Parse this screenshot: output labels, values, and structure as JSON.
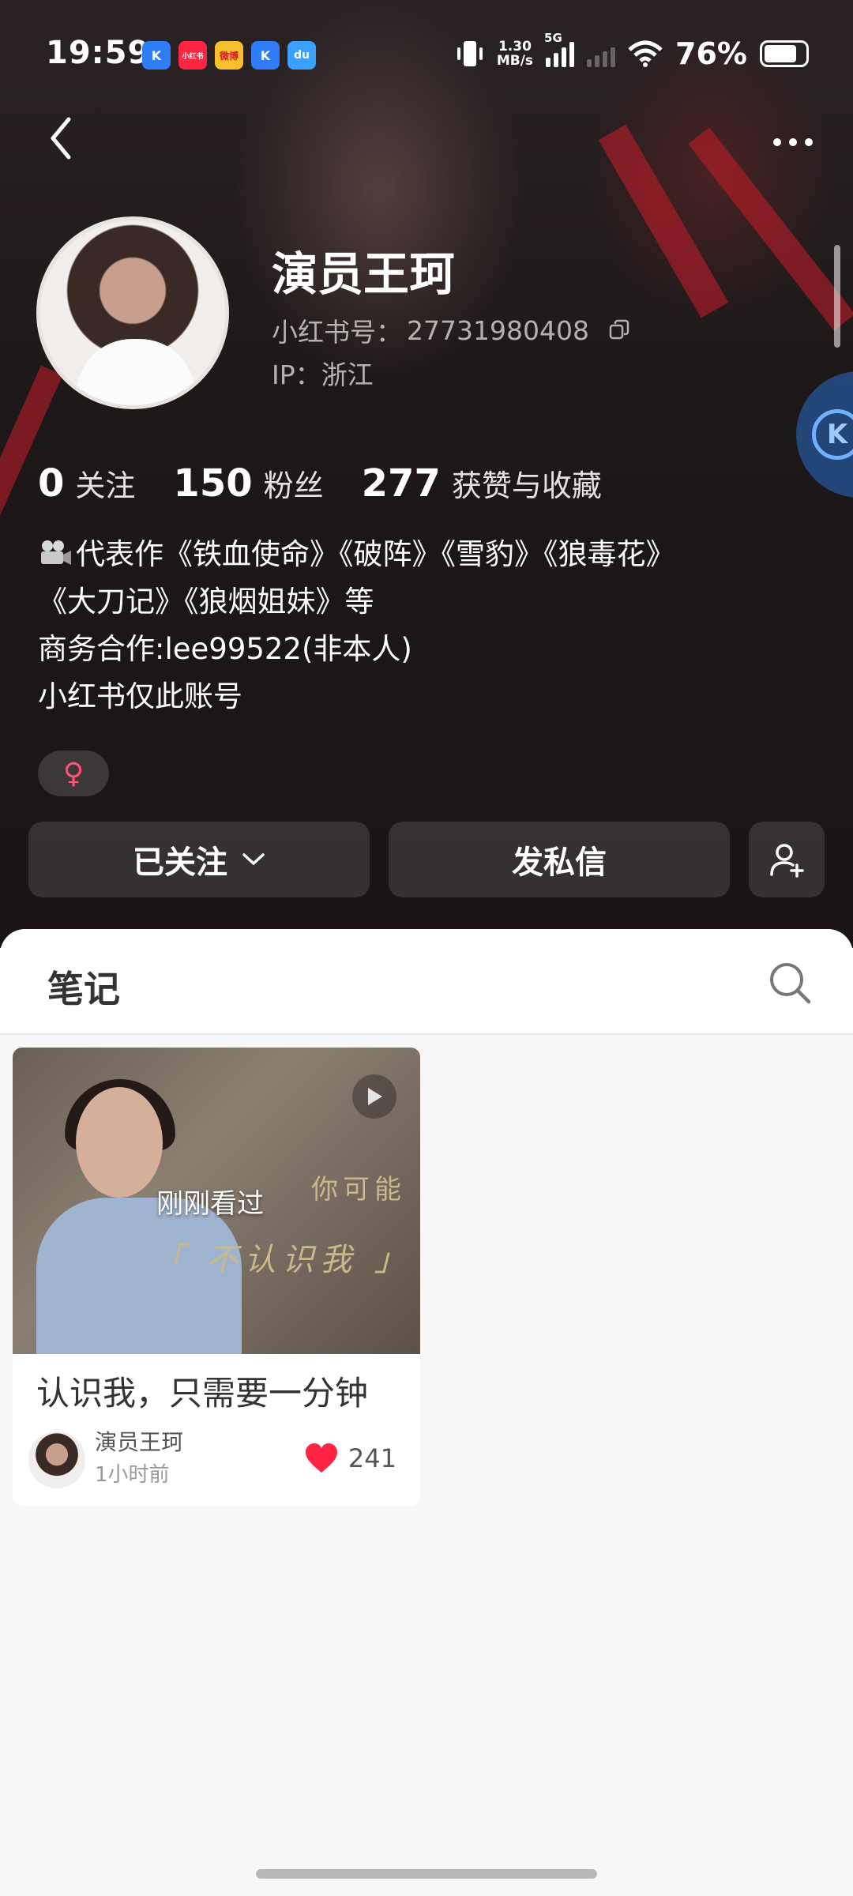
{
  "status_bar": {
    "time": "19:59",
    "net_speed_value": "1.30",
    "net_speed_unit": "MB/s",
    "network_type": "5G",
    "battery_percent": "76%",
    "app_icons": [
      "K",
      "小红书",
      "微博",
      "K",
      "du"
    ]
  },
  "profile": {
    "name": "演员王珂",
    "xhs_id_label": "小红书号：",
    "xhs_id": "27731980408",
    "ip": "IP：浙江",
    "stats": [
      {
        "value": "0",
        "label": "关注"
      },
      {
        "value": "150",
        "label": "粉丝"
      },
      {
        "value": "277",
        "label": "获赞与收藏"
      }
    ],
    "bio_lines": [
      "代表作《铁血使命》《破阵》《雪豹》《狼毒花》",
      "《大刀记》《狼烟姐妹》等",
      "商务合作:lee99522(非本人)",
      "小红书仅此账号"
    ],
    "gender_symbol": "♀",
    "side_badge": "K"
  },
  "actions": {
    "follow_label": "已关注",
    "message_label": "发私信"
  },
  "tabs": {
    "notes_label": "笔记"
  },
  "notes": [
    {
      "overlay": "刚刚看过",
      "cover_caption_1": "你可能",
      "cover_caption_2": "「 不认识我 」",
      "title": "认识我，只需要一分钟",
      "author": "演员王珂",
      "time": "1小时前",
      "likes": "241"
    }
  ],
  "colors": {
    "accent_like": "#ff2442",
    "gender_pink": "#ff4f7b"
  }
}
